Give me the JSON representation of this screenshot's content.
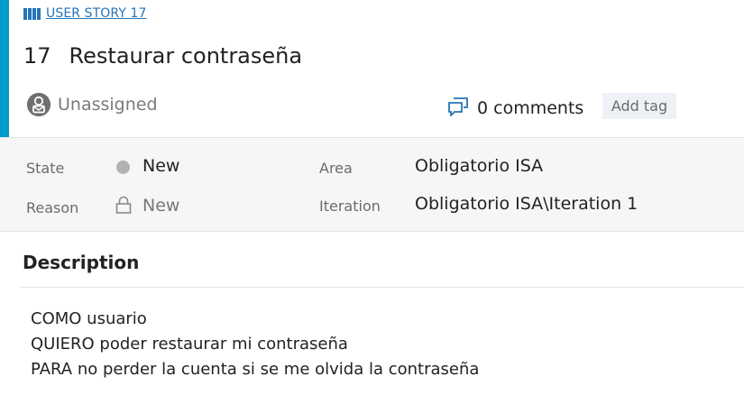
{
  "work_item": {
    "type_link": "USER STORY 17",
    "id": "17",
    "title": "Restaurar contraseña",
    "assigned_to": "Unassigned",
    "comments_label": "0 comments",
    "add_tag_label": "Add tag"
  },
  "fields": {
    "state_label": "State",
    "state_value": "New",
    "reason_label": "Reason",
    "reason_value": "New",
    "area_label": "Area",
    "area_value": "Obligatorio ISA",
    "iteration_label": "Iteration",
    "iteration_value": "Obligatorio ISA\\Iteration 1"
  },
  "description": {
    "heading": "Description",
    "lines": [
      "COMO usuario",
      "QUIERO poder restaurar mi contraseña",
      "PARA no perder la cuenta si se me olvida la contraseña"
    ]
  },
  "colors": {
    "accent": "#009ccc",
    "link": "#2574b8",
    "state_dot": "#b2b2b2"
  },
  "icons": [
    "book-icon",
    "person-icon",
    "comment-icon",
    "lock-icon"
  ]
}
